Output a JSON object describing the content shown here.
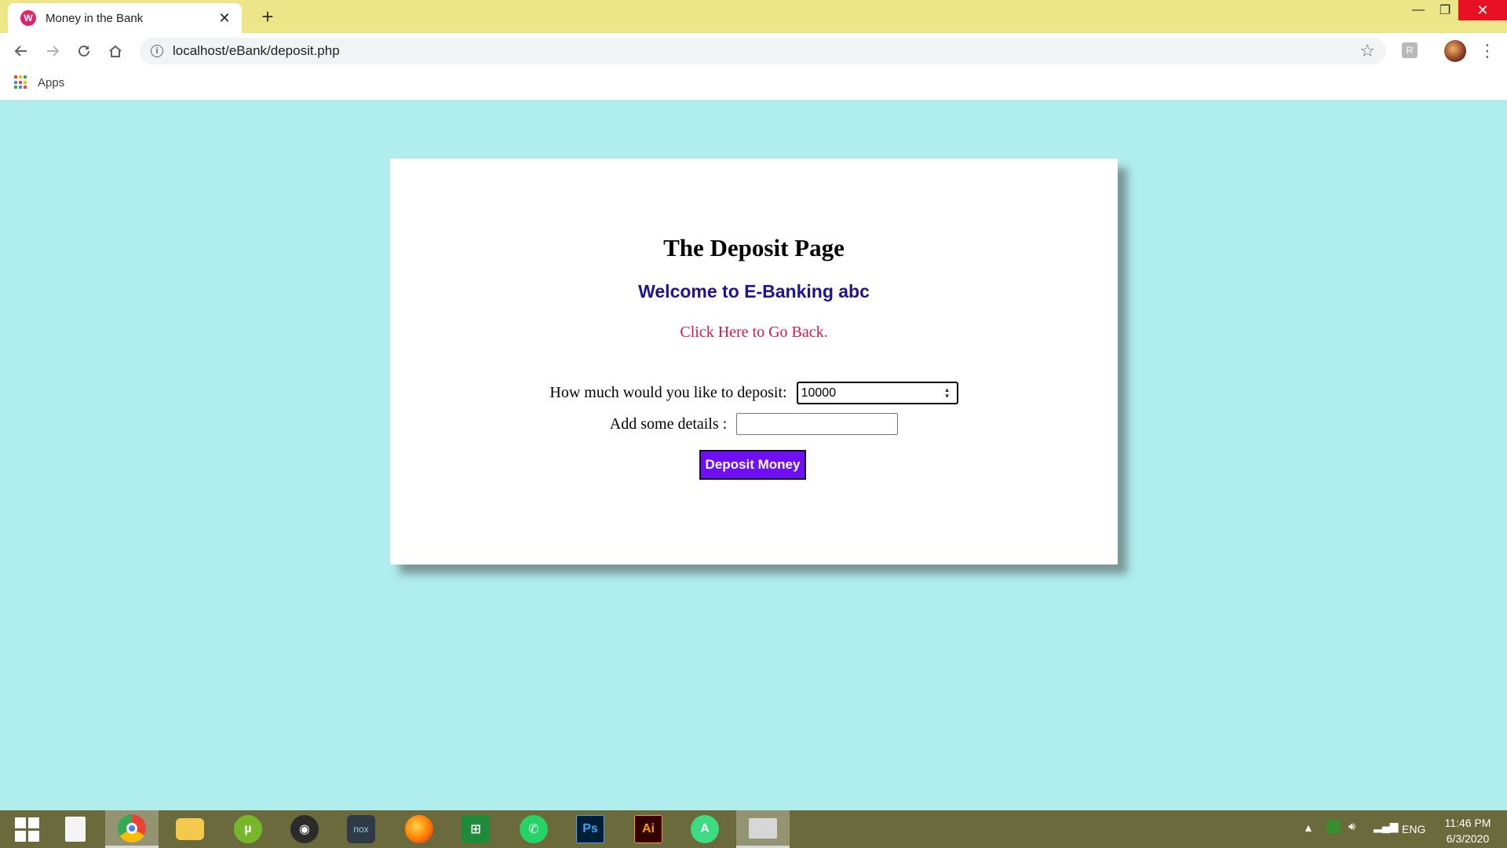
{
  "browser": {
    "tab_title": "Money in the Bank",
    "tab_favicon_text": "W",
    "url": "localhost/eBank/deposit.php",
    "bookmarks": [
      {
        "label": "Apps"
      }
    ],
    "extension_badge": "R"
  },
  "page": {
    "title": "The Deposit Page",
    "welcome": "Welcome to E-Banking abc",
    "back_link": "Click Here to Go Back.",
    "amount_label": "How much would you like to deposit:",
    "amount_value": "10000",
    "details_label": "Add some details :",
    "details_value": "",
    "submit_label": "Deposit Money"
  },
  "colors": {
    "page_background": "#afedee",
    "titlebar": "#ede688",
    "welcome_text": "#1e1396",
    "back_link": "#e0164d",
    "button": "#6f0ef7",
    "taskbar": "#6b6a3c"
  },
  "taskbar": {
    "apps": [
      {
        "icon": "chrome-icon",
        "active": true
      },
      {
        "icon": "file-explorer-icon"
      },
      {
        "icon": "utorrent-icon"
      },
      {
        "icon": "media-player-icon"
      },
      {
        "icon": "nox-icon",
        "text": "nox"
      },
      {
        "icon": "firefox-icon"
      },
      {
        "icon": "store-icon"
      },
      {
        "icon": "whatsapp-icon"
      },
      {
        "icon": "photoshop-icon",
        "text": "Ps"
      },
      {
        "icon": "illustrator-icon",
        "text": "Ai"
      },
      {
        "icon": "android-studio-icon"
      },
      {
        "icon": "window-app-icon",
        "active": true
      }
    ],
    "tray": {
      "language": "ENG",
      "time": "11:46 PM",
      "date": "6/3/2020"
    }
  }
}
